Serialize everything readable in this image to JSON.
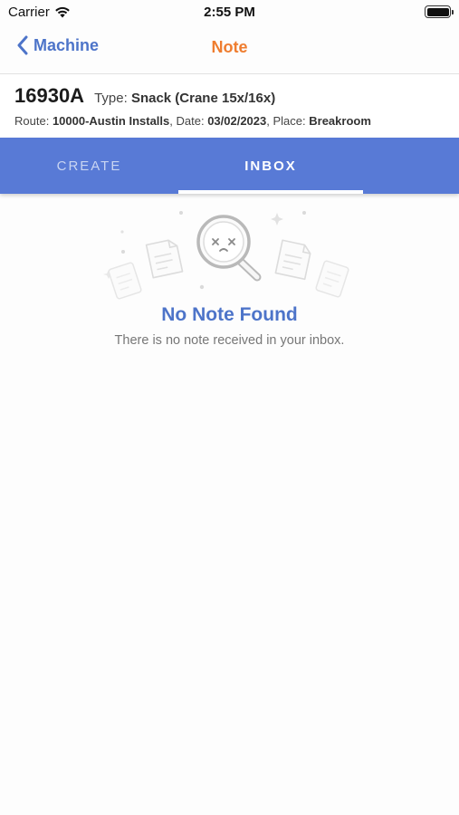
{
  "status_bar": {
    "carrier": "Carrier",
    "time": "2:55 PM"
  },
  "nav": {
    "back_label": "Machine",
    "title": "Note",
    "accent_color": "#4d74c9",
    "title_color": "#ef7d2f"
  },
  "machine": {
    "id": "16930A",
    "type_label": "Type:",
    "type_value": "Snack (Crane 15x/16x)",
    "route_label": "Route:",
    "route_value": "10000-Austin Installs",
    "date_label": ", Date:",
    "date_value": "03/02/2023",
    "place_label": ", Place:",
    "place_value": "Breakroom"
  },
  "tabs": [
    {
      "label": "CREATE",
      "active": false
    },
    {
      "label": "INBOX",
      "active": true
    }
  ],
  "tab_bar_color": "#587ad6",
  "empty_state": {
    "icon": "magnifier-sad-face-icon",
    "title": "No Note Found",
    "subtitle": "There is no note received in your inbox."
  }
}
